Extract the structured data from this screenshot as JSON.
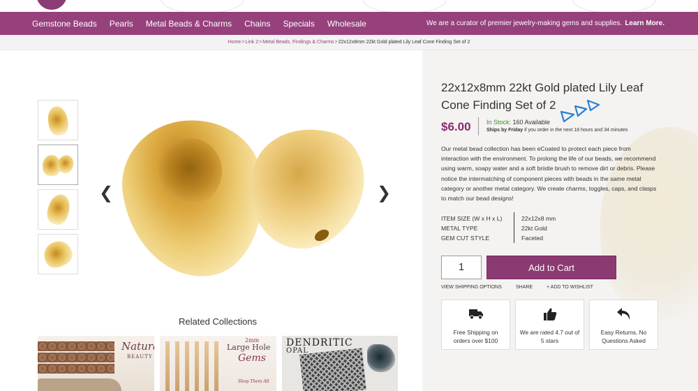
{
  "nav": {
    "items": [
      "Gemstone Beads",
      "Pearls",
      "Metal Beads & Charms",
      "Chains",
      "Specials",
      "Wholesale"
    ],
    "tagline": "We are a curator of premier jewelry-making gems and supplies.",
    "learn_more": "Learn More."
  },
  "breadcrumb": {
    "home": "Home",
    "link2": "Link 2",
    "link3": "Metal Beads, Findings & Charms",
    "current": "22x12x8mm 22kt Gold plated Lily Leaf Cone Finding Set of 2",
    "separator": ">"
  },
  "gallery": {
    "prev_glyph": "❮",
    "next_glyph": "❯"
  },
  "related": {
    "title": "Related Collections",
    "items": [
      {
        "text": "Natural",
        "subtext": "BEAUTY"
      },
      {
        "text": "Large Hole",
        "subtext": "Gems",
        "caption": "2mm",
        "small": "Shop Them All"
      },
      {
        "text": "DENDRITIC",
        "subtext": "OPAL"
      }
    ]
  },
  "product": {
    "title": "22x12x8mm 22kt Gold plated Lily Leaf Cone Finding Set of 2",
    "price": "$6.00",
    "stock_label": "In Stock:",
    "stock_value": "160 Available",
    "ships_bold": "Ships by Friday",
    "ships_rest": "if you order in the next 18 hours and 34 minutes",
    "description": "Our metal bead collection has been eCoated to protect each piece from interaction with the environment. To prolong the life of our beads, we recommend using warm, soapy water and a soft bristle brush to remove dirt or debris. Please notice the intermatching of component pieces with beads in the same metal category or another metal category. We create charms, toggles, caps, and clasps to match our bead designs!",
    "specs": [
      {
        "key": "ITEM SIZE (W x H x L)",
        "value": "22x12x8 mm"
      },
      {
        "key": "METAL TYPE",
        "value": "22kt Gold"
      },
      {
        "key": "GEM CUT STYLE",
        "value": "Faceted"
      }
    ],
    "quantity": "1",
    "add_to_cart": "Add to Cart",
    "links": [
      "VIEW SHIPPING OPTIONS",
      "SHARE",
      "+ ADD TO WISHLIST"
    ]
  },
  "features": [
    {
      "icon": "truck-icon",
      "glyph": "🚚",
      "text": "Free Shipping on orders over $100"
    },
    {
      "icon": "thumbs-up-icon",
      "glyph": "👍",
      "text": "We are rated 4.7 out of 5 stars"
    },
    {
      "icon": "return-arrow-icon",
      "glyph": "↩",
      "text": "Easy Returns, No Questions Asked"
    }
  ],
  "colors": {
    "brand": "#96407c",
    "price": "#8b2a6f",
    "in_stock": "#3f8a2a",
    "annotation": "#2a7fd4"
  }
}
